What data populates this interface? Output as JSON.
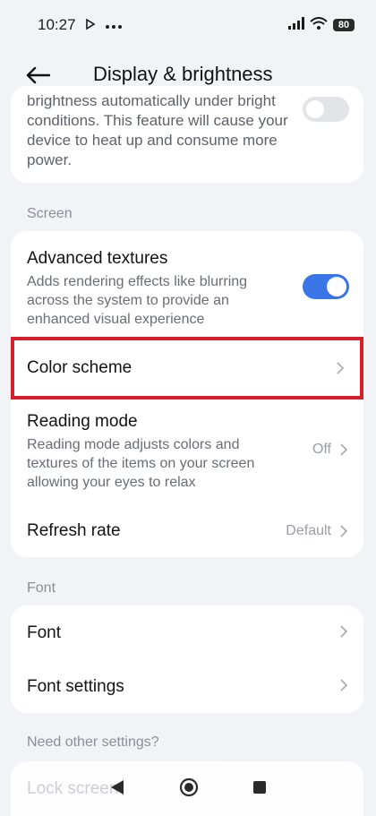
{
  "status": {
    "time": "10:27",
    "battery": "80"
  },
  "header": {
    "title": "Display & brightness"
  },
  "top_card": {
    "description": "brightness automatically under bright conditions. This feature will cause your device to heat up and consume more power."
  },
  "sections": {
    "screen": "Screen",
    "font": "Font",
    "other": "Need other settings?"
  },
  "screen_card": {
    "advanced_textures": {
      "title": "Advanced textures",
      "subtitle": "Adds rendering effects like blurring across the system to provide an enhanced visual experience",
      "enabled": true
    },
    "color_scheme": {
      "title": "Color scheme"
    },
    "reading_mode": {
      "title": "Reading mode",
      "subtitle": "Reading mode adjusts colors and textures of the items on your screen allowing your eyes to relax",
      "value": "Off"
    },
    "refresh_rate": {
      "title": "Refresh rate",
      "value": "Default"
    }
  },
  "font_card": {
    "font": {
      "title": "Font"
    },
    "font_settings": {
      "title": "Font settings"
    }
  },
  "other_card": {
    "lock_screen": {
      "title": "Lock screen"
    }
  },
  "icons": [
    "play-icon",
    "more-dots-icon",
    "signal-icon",
    "wifi-icon",
    "battery-icon",
    "back-arrow-icon",
    "chevron-right-icon",
    "nav-back-icon",
    "nav-home-icon",
    "nav-recents-icon"
  ]
}
